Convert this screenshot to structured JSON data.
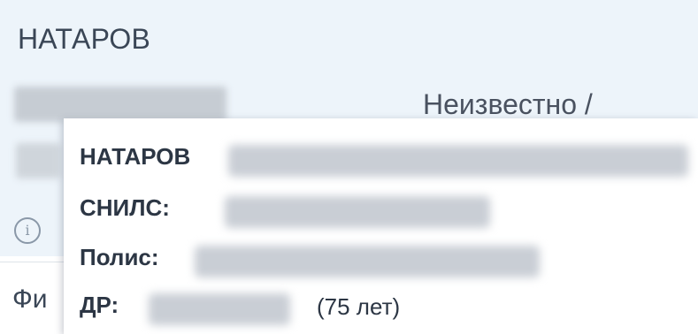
{
  "patient_card": {
    "surname": "НАТАРОВ",
    "gender": "Неизвестно /",
    "section_label": "Фи"
  },
  "tooltip": {
    "surname": "НАТАРОВ",
    "snils_label": "СНИЛС:",
    "policy_label": "Полис:",
    "dob_label": "ДР:",
    "age": "(75 лет)"
  },
  "icons": {
    "info": "info-icon"
  }
}
